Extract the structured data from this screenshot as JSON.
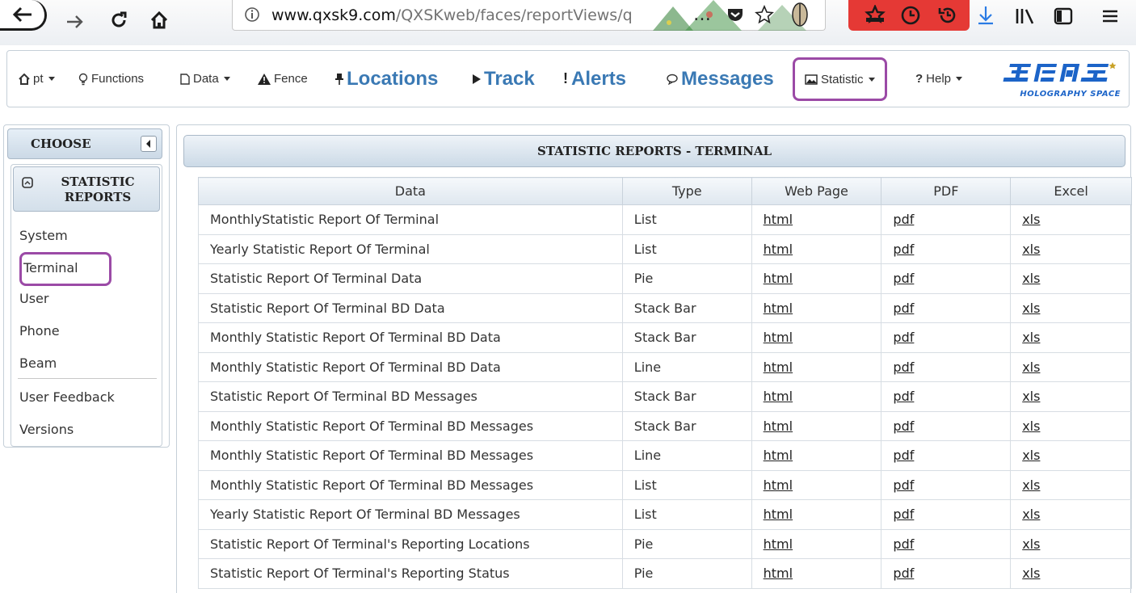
{
  "browser": {
    "url_host": "www.qxsk9.com",
    "url_path": "/QXSKweb/faces/reportViews/q",
    "page_actions_label": "…"
  },
  "menu": {
    "items": [
      {
        "label": "pt",
        "icon": "home-icon"
      },
      {
        "label": "Functions",
        "icon": "lightbulb-icon"
      },
      {
        "label": "Data",
        "icon": "file-icon"
      },
      {
        "label": "Fence",
        "icon": "warning-icon"
      },
      {
        "label": "Locations",
        "icon": "pin-icon"
      },
      {
        "label": "Track",
        "icon": "play-icon"
      },
      {
        "label": "Alerts",
        "icon": "exclamation-icon"
      },
      {
        "label": "Messages",
        "icon": "comment-icon"
      },
      {
        "label": "Statistic",
        "icon": "picture-icon"
      },
      {
        "label": "Help",
        "icon": "question-icon"
      }
    ],
    "logo_subtitle": "HOLOGRAPHY SPACE"
  },
  "sidebar": {
    "header": "CHOOSE",
    "card_title": "STATISTIC REPORTS",
    "items": [
      "System",
      "Terminal",
      "User",
      "Phone",
      "Beam",
      "User Feedback",
      "Versions"
    ]
  },
  "main": {
    "title": "STATISTIC REPORTS - TERMINAL",
    "columns": [
      "Data",
      "Type",
      "Web Page",
      "PDF",
      "Excel"
    ],
    "rows": [
      {
        "data": "MonthlyStatistic Report Of Terminal",
        "type": "List",
        "web": "html",
        "pdf": "pdf",
        "excel": "xls"
      },
      {
        "data": "Yearly Statistic Report Of Terminal",
        "type": "List",
        "web": "html",
        "pdf": "pdf",
        "excel": "xls"
      },
      {
        "data": "Statistic Report Of Terminal Data",
        "type": "Pie",
        "web": "html",
        "pdf": "pdf",
        "excel": "xls"
      },
      {
        "data": "Statistic Report Of Terminal BD Data",
        "type": "Stack Bar",
        "web": "html",
        "pdf": "pdf",
        "excel": "xls"
      },
      {
        "data": "Monthly Statistic Report Of Terminal BD Data",
        "type": "Stack Bar",
        "web": "html",
        "pdf": "pdf",
        "excel": "xls"
      },
      {
        "data": "Monthly Statistic Report Of Terminal BD Data",
        "type": "Line",
        "web": "html",
        "pdf": "pdf",
        "excel": "xls"
      },
      {
        "data": "Statistic Report Of Terminal BD Messages",
        "type": "Stack Bar",
        "web": "html",
        "pdf": "pdf",
        "excel": "xls"
      },
      {
        "data": "Monthly Statistic Report Of Terminal BD Messages",
        "type": "Stack Bar",
        "web": "html",
        "pdf": "pdf",
        "excel": "xls"
      },
      {
        "data": "Monthly Statistic Report Of Terminal BD Messages",
        "type": "Line",
        "web": "html",
        "pdf": "pdf",
        "excel": "xls"
      },
      {
        "data": "Monthly Statistic Report Of Terminal BD Messages",
        "type": "List",
        "web": "html",
        "pdf": "pdf",
        "excel": "xls"
      },
      {
        "data": "Yearly Statistic Report Of Terminal BD Messages",
        "type": "List",
        "web": "html",
        "pdf": "pdf",
        "excel": "xls"
      },
      {
        "data": "Statistic Report Of Terminal's Reporting Locations",
        "type": "Pie",
        "web": "html",
        "pdf": "pdf",
        "excel": "xls"
      },
      {
        "data": "Statistic Report Of Terminal's Reporting Status",
        "type": "Pie",
        "web": "html",
        "pdf": "pdf",
        "excel": "xls"
      }
    ]
  },
  "colors": {
    "accent_blue": "#3a79b4",
    "highlight_purple": "#9b4aa6",
    "logo_blue": "#1c64c8"
  }
}
